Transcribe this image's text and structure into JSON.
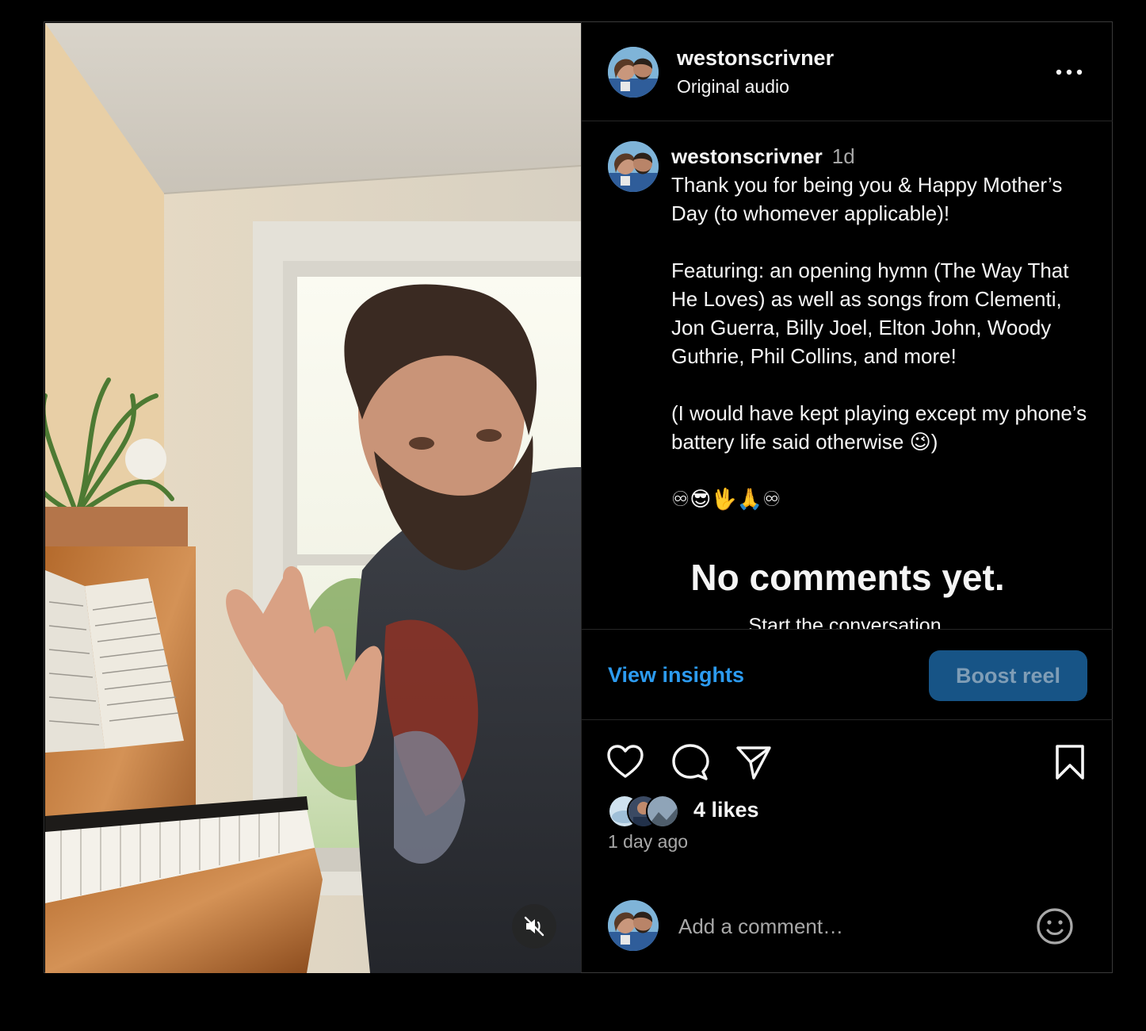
{
  "post": {
    "username": "westonscrivner",
    "audio_label": "Original audio",
    "caption": {
      "username": "westonscrivner",
      "time": "1d",
      "text": "Thank you for being you & Happy Mother’s Day (to whomever applicable)!\n\nFeaturing: an opening hymn (The Way That He Loves) as well as songs from Clementi, Jon Guerra, Billy Joel, Elton John, Woody Guthrie, Phil Collins, and more!\n\n(I would have kept playing except my phone’s battery life said otherwise 😉)\n\n♾😎🖖🙏♾"
    },
    "comments_empty": {
      "title": "No comments yet.",
      "subtitle": "Start the conversation."
    },
    "actions": {
      "insights_label": "View insights",
      "boost_label": "Boost reel"
    },
    "likes": {
      "count_text": "4 likes"
    },
    "time_ago": "1 day ago",
    "comment_input": {
      "placeholder": "Add a comment…"
    }
  },
  "icons": {
    "more": "more-horizontal-icon",
    "like": "heart-icon",
    "comment": "comment-bubble-icon",
    "share": "paper-plane-icon",
    "save": "bookmark-icon",
    "emoji": "smiley-icon",
    "mute": "speaker-muted-icon"
  },
  "colors": {
    "background": "#000000",
    "text": "#f5f5f5",
    "muted_text": "#a8a8a8",
    "link_blue": "#2c9bf0",
    "boost_button": "#175486",
    "divider": "#262626"
  }
}
